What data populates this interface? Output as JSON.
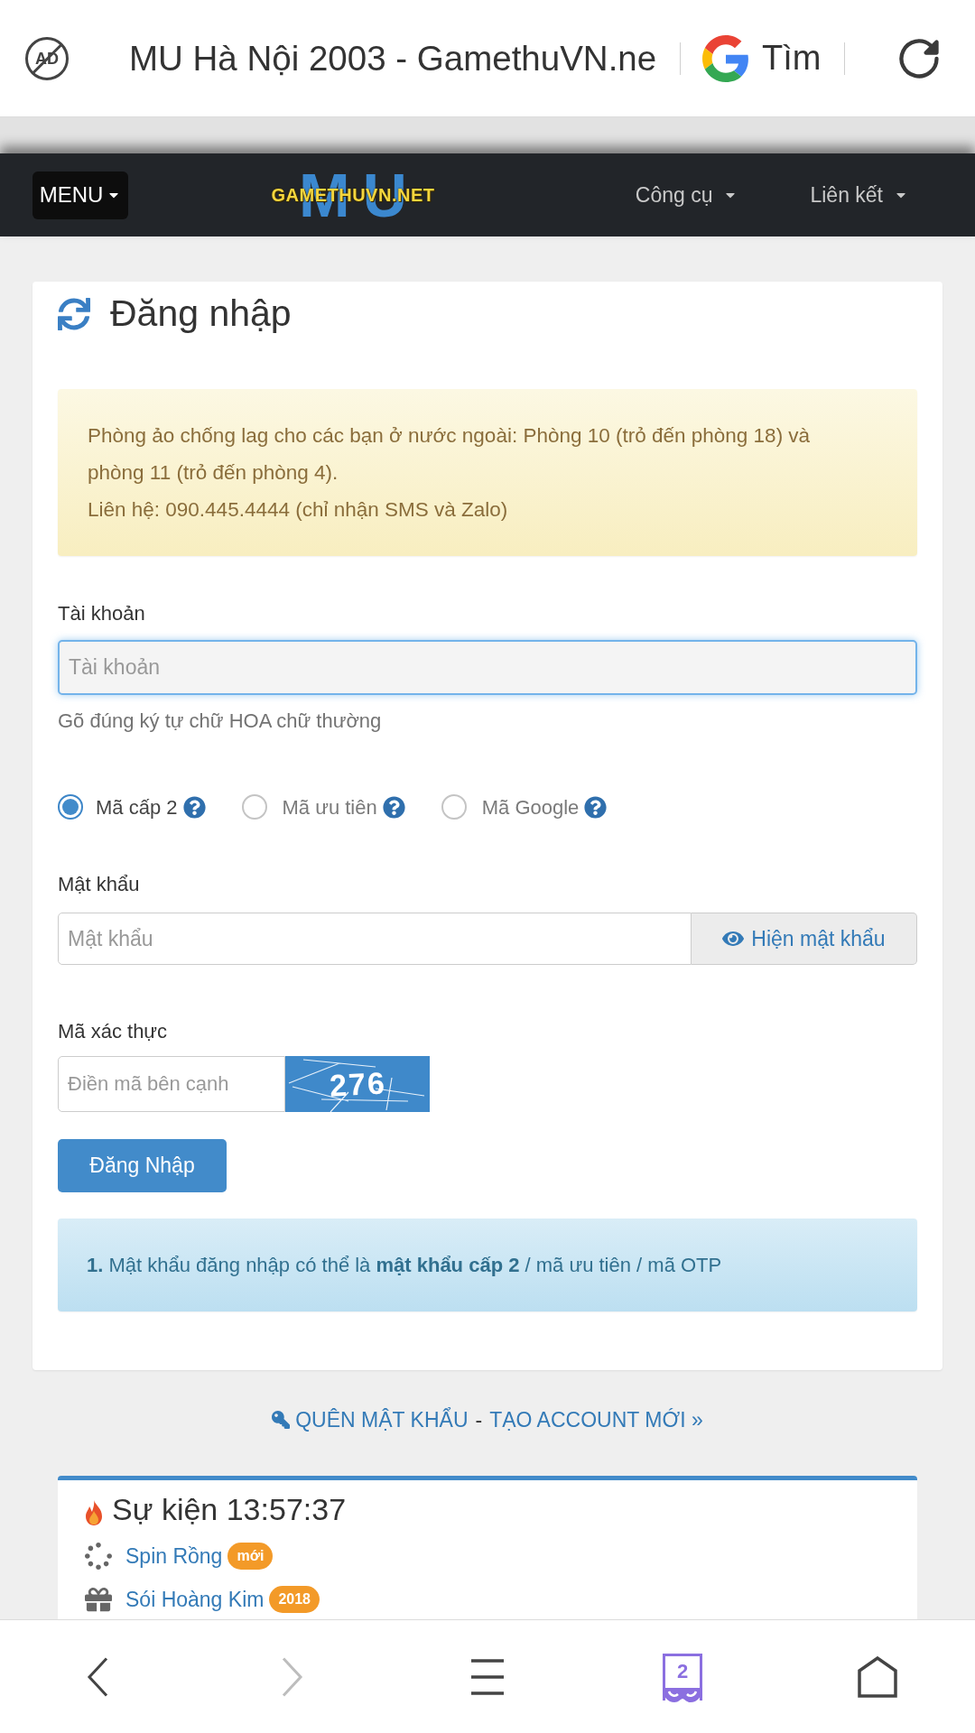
{
  "browser_bar": {
    "adblock_label": "AD",
    "page_title": "MU Hà Nội 2003 - GamethuVN.ne",
    "search_label": "Tìm"
  },
  "navbar": {
    "menu_button": "MENU",
    "logo": {
      "backdrop": "MU",
      "text": "GAMETHUVN.NET"
    },
    "links": [
      {
        "label": "Công cụ"
      },
      {
        "label": "Liên kết"
      }
    ]
  },
  "login_card": {
    "title": "Đăng nhập",
    "notice": [
      "Phòng ảo chống lag cho các bạn ở nước ngoài: Phòng 10 (trỏ đến phòng 18) và phòng 11 (trỏ đến phòng 4).",
      "Liên hệ: 090.445.4444 (chỉ nhận SMS và Zalo)"
    ],
    "account": {
      "label": "Tài khoản",
      "placeholder": "Tài khoản",
      "focused": true,
      "help": "Gõ đúng ký tự chữ HOA chữ thường"
    },
    "code_types": [
      {
        "label": "Mã cấp 2",
        "selected": true
      },
      {
        "label": "Mã ưu tiên",
        "selected": false
      },
      {
        "label": "Mã Google",
        "selected": false
      }
    ],
    "password": {
      "label": "Mật khẩu",
      "placeholder": "Mật khẩu",
      "toggle": "Hiện mật khẩu"
    },
    "captcha": {
      "label": "Mã xác thực",
      "placeholder": "Điền mã bên cạnh",
      "code": "276"
    },
    "submit": "Đăng Nhập",
    "tips": [
      "**1.** Mật khẩu đăng nhập có thể là **mật khẩu cấp 2** / mã ưu tiên / mã OTP"
    ]
  },
  "account_links": {
    "forgot": "QUÊN MẬT KHẨU",
    "separator": "-",
    "register": "TẠO ACCOUNT MỚI »"
  },
  "events": {
    "title": "Sự kiện 13:57:37",
    "items": [
      {
        "kind": "spinner",
        "label": "Spin Rồng",
        "badge": "mới"
      },
      {
        "kind": "gift",
        "label": "Sói Hoàng Kim",
        "badge": "2018"
      }
    ]
  },
  "bottom_bar": {
    "buttons": [
      {
        "kind": "back",
        "disabled": false
      },
      {
        "kind": "forward",
        "disabled": true
      },
      {
        "kind": "menu",
        "disabled": false
      },
      {
        "kind": "tabs",
        "count": "2",
        "disabled": false
      },
      {
        "kind": "home",
        "disabled": false
      }
    ]
  }
}
